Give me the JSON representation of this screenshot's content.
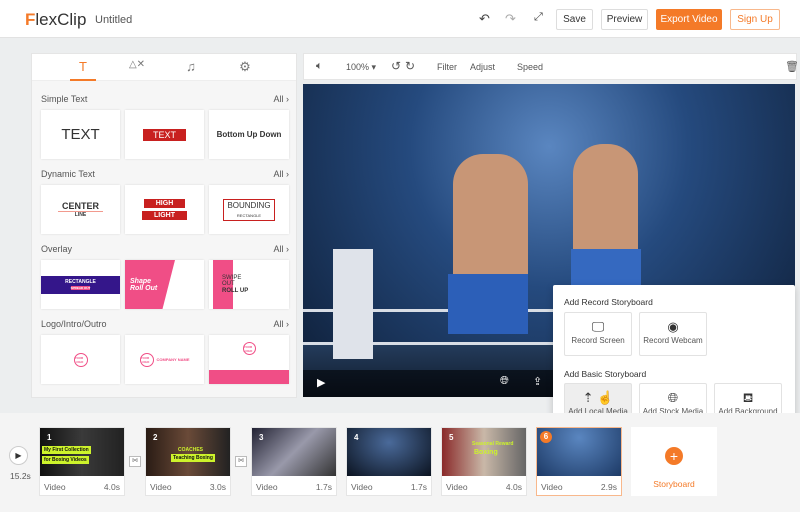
{
  "header": {
    "logo": "FlexClip",
    "title": "Untitled",
    "save": "Save",
    "preview": "Preview",
    "export": "Export Video",
    "signup": "Sign Up",
    "undo_icon": "undo-icon",
    "redo_icon": "redo-icon",
    "fullscreen_icon": "fullscreen-icon"
  },
  "colors": {
    "accent": "#f47a28",
    "pink": "#f04e86",
    "red": "#c8201f",
    "navy": "#34168a"
  },
  "left_panel": {
    "tabs": [
      "T",
      "shapes",
      "music",
      "settings"
    ],
    "sections": [
      {
        "title": "Simple Text",
        "all": "All",
        "cards": [
          "TEXT",
          "TEXT",
          "Bottom Up Down"
        ]
      },
      {
        "title": "Dynamic Text",
        "all": "All",
        "cards": [
          "CENTER",
          "LINE",
          "HIGH",
          "LIGHT",
          "BOUNDING",
          "RECTANGLE"
        ]
      },
      {
        "title": "Overlay",
        "all": "All",
        "cards": [
          "RECTANGLE",
          "SPREAD OUT",
          "Shape",
          "Roll Out",
          "SWIPE",
          "OUT",
          "ROLL UP"
        ]
      },
      {
        "title": "Logo/Intro/Outro",
        "all": "All",
        "cards": [
          "YOUR LOGO",
          "YOUR LOGO",
          "COMPANY NAME",
          "YOUR LOGO"
        ]
      }
    ]
  },
  "toolbar": {
    "zoom": "100% ▾",
    "filter": "Filter",
    "adjust": "Adjust",
    "speed": "Speed"
  },
  "popup": {
    "record_title": "Add Record Storyboard",
    "record_screen": "Record Screen",
    "record_webcam": "Record Webcam",
    "basic_title": "Add Basic Storyboard",
    "local": "Add Local Media",
    "stock": "Add Stock Media",
    "background": "Add Background"
  },
  "timeline": {
    "total": "15.2s",
    "add_label": "Storyboard",
    "clips": [
      {
        "num": "1",
        "label": "Video",
        "duration": "4.0s",
        "captions": [
          "My First Collection",
          "for Boxing Videos"
        ]
      },
      {
        "num": "2",
        "label": "Video",
        "duration": "3.0s",
        "captions": [
          "COACHES",
          "Teaching Boxing"
        ]
      },
      {
        "num": "3",
        "label": "Video",
        "duration": "1.7s"
      },
      {
        "num": "4",
        "label": "Video",
        "duration": "1.7s"
      },
      {
        "num": "5",
        "label": "Video",
        "duration": "4.0s",
        "captions": [
          "Seasonal Reward",
          "Boxing"
        ]
      },
      {
        "num": "6",
        "label": "Video",
        "duration": "2.9s"
      }
    ]
  }
}
